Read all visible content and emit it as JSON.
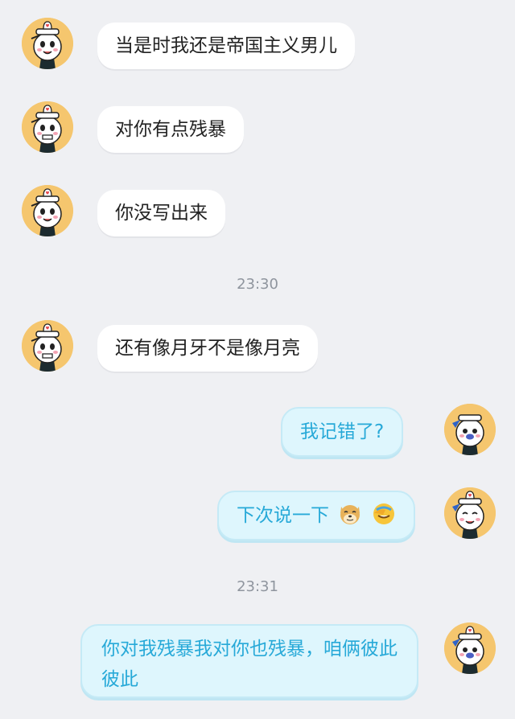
{
  "chat": {
    "messages": [
      {
        "side": "left",
        "text": "当是时我还是帝国主义男儿"
      },
      {
        "side": "left",
        "text": "对你有点残暴"
      },
      {
        "side": "left",
        "text": "你没写出来"
      },
      {
        "type": "time",
        "text": "23:30"
      },
      {
        "side": "left",
        "text": "还有像月牙不是像月亮"
      },
      {
        "side": "right",
        "text": "我记错了?"
      },
      {
        "side": "right",
        "text": "下次说一下",
        "emojis": [
          "doge-emoji",
          "facepalm-laugh-emoji"
        ]
      },
      {
        "type": "time",
        "text": "23:31"
      },
      {
        "side": "right",
        "text": "你对我残暴我对你也残暴，咱俩彼此彼此"
      }
    ]
  },
  "colors": {
    "background": "#eff0f3",
    "left_bubble": "#ffffff",
    "right_bubble": "#def6fd",
    "right_text": "#27a9d8",
    "avatar_bg": "#f5c66e"
  }
}
